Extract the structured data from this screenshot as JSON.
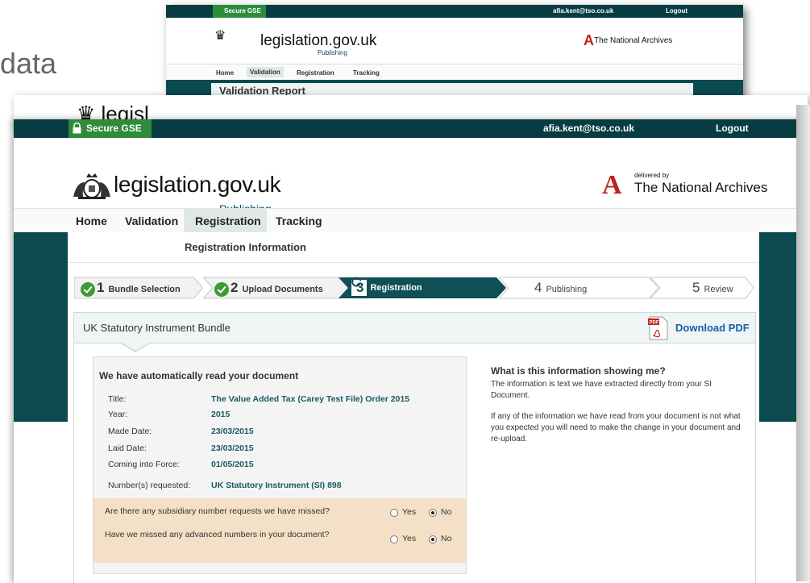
{
  "slide": {
    "title_fragment": "data"
  },
  "background_screenshot": {
    "secure_label": "Secure GSE",
    "user_email": "afia.kent@tso.co.uk",
    "logout": "Logout",
    "logo_text": "legislation.gov.uk",
    "publishing": "Publishing",
    "tna_delivered_by": "delivered by",
    "tna_name": "The National Archives",
    "nav": [
      "Home",
      "Validation",
      "Registration",
      "Tracking"
    ],
    "active_nav": "Validation",
    "report_title": "Validation Report"
  },
  "topbar": {
    "secure_label": "Secure GSE",
    "user_email": "afia.kent@tso.co.uk",
    "logout": "Logout"
  },
  "header": {
    "logo_text": "legislation.gov.uk",
    "subtitle": "Publishing",
    "tna_delivered_by": "delivered by",
    "tna_name": "The National Archives"
  },
  "nav": {
    "items": [
      "Home",
      "Validation",
      "Registration",
      "Tracking"
    ],
    "active": "Registration"
  },
  "panel": {
    "title": "Registration Information"
  },
  "steps": [
    {
      "num": "1",
      "label": "Bundle Selection",
      "state": "done"
    },
    {
      "num": "2",
      "label": "Upload Documents",
      "state": "done"
    },
    {
      "num": "3",
      "label": "Registration",
      "state": "current"
    },
    {
      "num": "4",
      "label": "Publishing",
      "state": "todo"
    },
    {
      "num": "5",
      "label": "Review",
      "state": "todo"
    }
  ],
  "card": {
    "title": "UK Statutory Instrument Bundle",
    "download_label": "Download PDF"
  },
  "info": {
    "heading": "We have automatically read your document",
    "fields": [
      {
        "label": "Title:",
        "value": "The Value Added Tax (Carey Test File) Order 2015"
      },
      {
        "label": "Year:",
        "value": "2015"
      },
      {
        "label": "Made Date:",
        "value": "23/03/2015"
      },
      {
        "label": "Laid Date:",
        "value": "23/03/2015"
      },
      {
        "label": "Coming into Force:",
        "value": "01/05/2015"
      },
      {
        "label": "Number(s) requested:",
        "value": "UK Statutory Instrument (SI) 898"
      }
    ],
    "questions": [
      {
        "text": "Are there any subsidiary number requests we have missed?",
        "yes": "Yes",
        "no": "No",
        "selected": "No"
      },
      {
        "text": "Have we missed any advanced numbers in your document?",
        "yes": "Yes",
        "no": "No",
        "selected": "No"
      }
    ]
  },
  "help": {
    "heading": "What is this information showing me?",
    "para1": "The information is text we have extracted directly from your SI Document.",
    "para2": "If any of the information we have read from your document is not what you expected you will need to make the change in your document and re-upload."
  },
  "colors": {
    "topbar": "#073c43",
    "secure_green": "#2e8b3a",
    "band": "#0b4a4f",
    "step_current": "#0f4f56",
    "link_blue": "#1a5fa8",
    "question_bg": "#f3e0c7"
  }
}
